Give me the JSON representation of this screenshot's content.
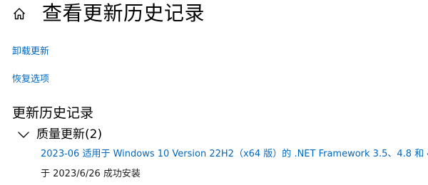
{
  "header": {
    "title": "查看更新历史记录",
    "home_icon": "home-icon"
  },
  "links": {
    "uninstall": "卸载更新",
    "recovery": "恢复选项"
  },
  "history": {
    "section_title": "更新历史记录",
    "groups": [
      {
        "label": "质量更新(2)",
        "expanded": true,
        "chevron_icon": "chevron-down-icon",
        "items": [
          {
            "title": "2023-06 适用于 Windows 10 Version 22H2（x64 版）的 .NET Framework 3.5、4.8 和 4.8.",
            "status": "于 2023/6/26 成功安装"
          }
        ]
      }
    ]
  },
  "colors": {
    "link": "#0067c0",
    "text": "#000000",
    "background": "#ffffff"
  }
}
